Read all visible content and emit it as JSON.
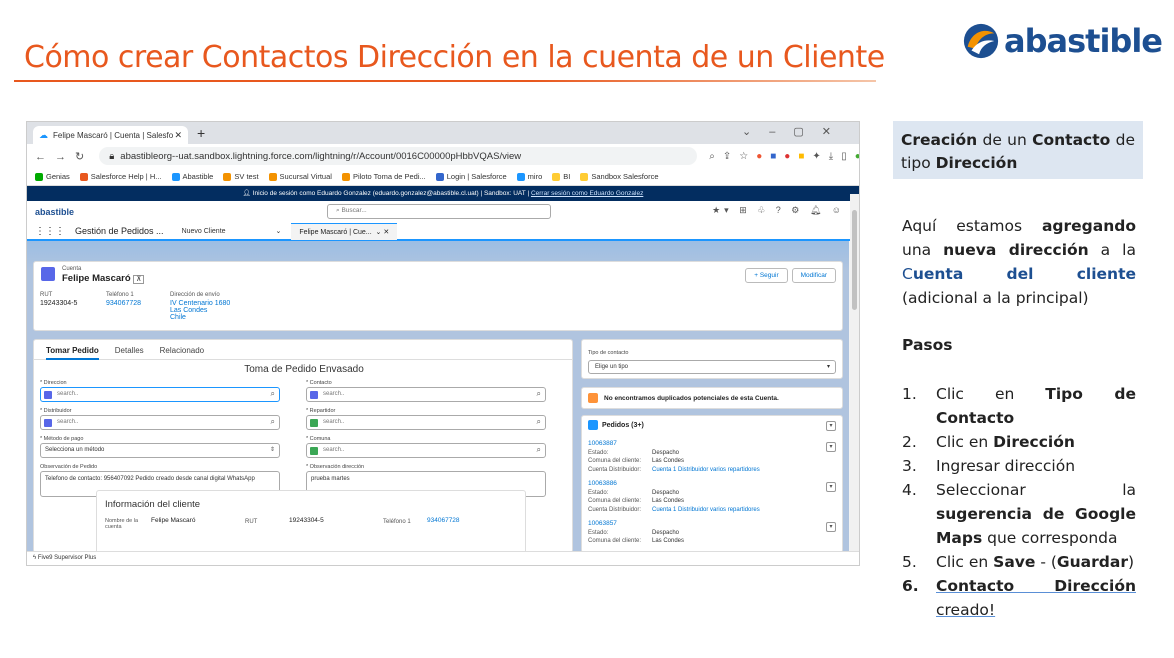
{
  "slide": {
    "title": "Cómo crear Contactos Dirección en la cuenta de un Cliente",
    "logo_text": "abastible"
  },
  "browser": {
    "tab_title": "Felipe Mascaró | Cuenta | Salesfo",
    "url": "abastibleorg--uat.sandbox.lightning.force.com/lightning/r/Account/0016C00000pHbbVQAS/view",
    "bookmarks": [
      "Genias",
      "Salesforce Help | H...",
      "Abastible",
      "SV test",
      "Sucursal Virtual",
      "Piloto Toma de Pedi...",
      "Login | Salesforce",
      "miro",
      "BI",
      "Sandbox Salesforce"
    ]
  },
  "salesforce": {
    "login_banner": "Inicio de sesión como Eduardo Gonzalez (eduardo.gonzalez@abastible.cl.uat) | Sandbox: UAT |",
    "logout_link": "Cerrar sesión como Eduardo Gonzalez",
    "brand": "abastible",
    "search_placeholder": "Buscar...",
    "app_name": "Gestión de Pedidos ...",
    "nav_new_client": "Nuevo Cliente",
    "nav_current_tab": "Felipe Mascaró | Cue...",
    "record": {
      "object": "Cuenta",
      "name": "Felipe Mascaró",
      "follow_btn": "+ Seguir",
      "edit_btn": "Modificar",
      "rut_label": "RUT",
      "rut": "19243304-5",
      "phone_label": "Teléfono 1",
      "phone": "934067728",
      "address_label": "Dirección de envío",
      "address_lines": [
        "IV Centenario 1680",
        "Las Condes",
        "Chile"
      ]
    },
    "tabs": [
      "Tomar Pedido",
      "Detalles",
      "Relacionado"
    ],
    "form": {
      "title": "Toma de Pedido Envasado",
      "direccion_label": "* Direccion",
      "contacto_label": "* Contacto",
      "distribuidor_label": "* Distribuidor",
      "repartidor_label": "* Repartidor",
      "metodo_label": "* Método de pago",
      "comuna_label": "* Comuna",
      "obs_pedido_label": "Observación de Pedido",
      "obs_dir_label": "* Observación dirección",
      "search_placeholder": "search..",
      "metodo_value": "Selecciona un método",
      "obs_pedido_value": "Telefono de contacto: 956407092 Pedido creado desde canal digital WhatsApp",
      "obs_dir_value": "prueba martes"
    },
    "info": {
      "title": "Información del cliente",
      "name_label": "Nombre de la cuenta",
      "name": "Felipe Mascaró",
      "rut_label": "RUT",
      "rut": "19243304-5",
      "phone_label": "Teléfono 1",
      "phone": "934067728"
    },
    "contact_type": {
      "label": "Tipo de contacto",
      "value": "Elige un tipo"
    },
    "duplicates_msg": "No encontramos duplicados potenciales de esta Cuenta.",
    "pedidos": {
      "title": "Pedidos (3+)",
      "labels": [
        "Estado:",
        "Comuna del cliente:",
        "Cuenta Distribuidor:"
      ],
      "items": [
        {
          "id": "10063887",
          "estado": "Despacho",
          "comuna": "Las Condes",
          "cuenta": "Cuenta 1 Distribuidor varios repartidores"
        },
        {
          "id": "10063886",
          "estado": "Despacho",
          "comuna": "Las Condes",
          "cuenta": "Cuenta 1 Distribuidor varios repartidores"
        },
        {
          "id": "10063857",
          "estado": "Despacho",
          "comuna": "Las Condes",
          "cuenta": ""
        }
      ]
    },
    "footer": "Five9 Supervisor Plus"
  },
  "panel": {
    "box_parts": [
      "Creación",
      " de un ",
      "Contacto",
      " de tipo ",
      "Dirección"
    ],
    "intro_parts": [
      "Aquí estamos ",
      "agregando",
      " una ",
      "nueva dirección",
      " a la ",
      "C",
      "uenta del cliente",
      " (adicional a la principal)"
    ],
    "pasos": "Pasos",
    "steps": [
      {
        "n": "1.",
        "pre": "Clic en ",
        "bold": "Tipo de Contacto",
        "post": ""
      },
      {
        "n": "2.",
        "pre": "Clic en ",
        "bold": "Dirección",
        "post": ""
      },
      {
        "n": "3.",
        "pre": "Ingresar dirección",
        "bold": "",
        "post": ""
      },
      {
        "n": "4.",
        "pre": "Seleccionar la ",
        "bold": "sugerencia de Google Maps",
        "post": " que corresponda"
      },
      {
        "n": "5.",
        "pre": "Clic en ",
        "bold": "Save",
        "post": " - (Guardar)"
      },
      {
        "n": "6.",
        "pre": "",
        "bold": "Contacto Dirección",
        "post": " creado!"
      }
    ]
  }
}
